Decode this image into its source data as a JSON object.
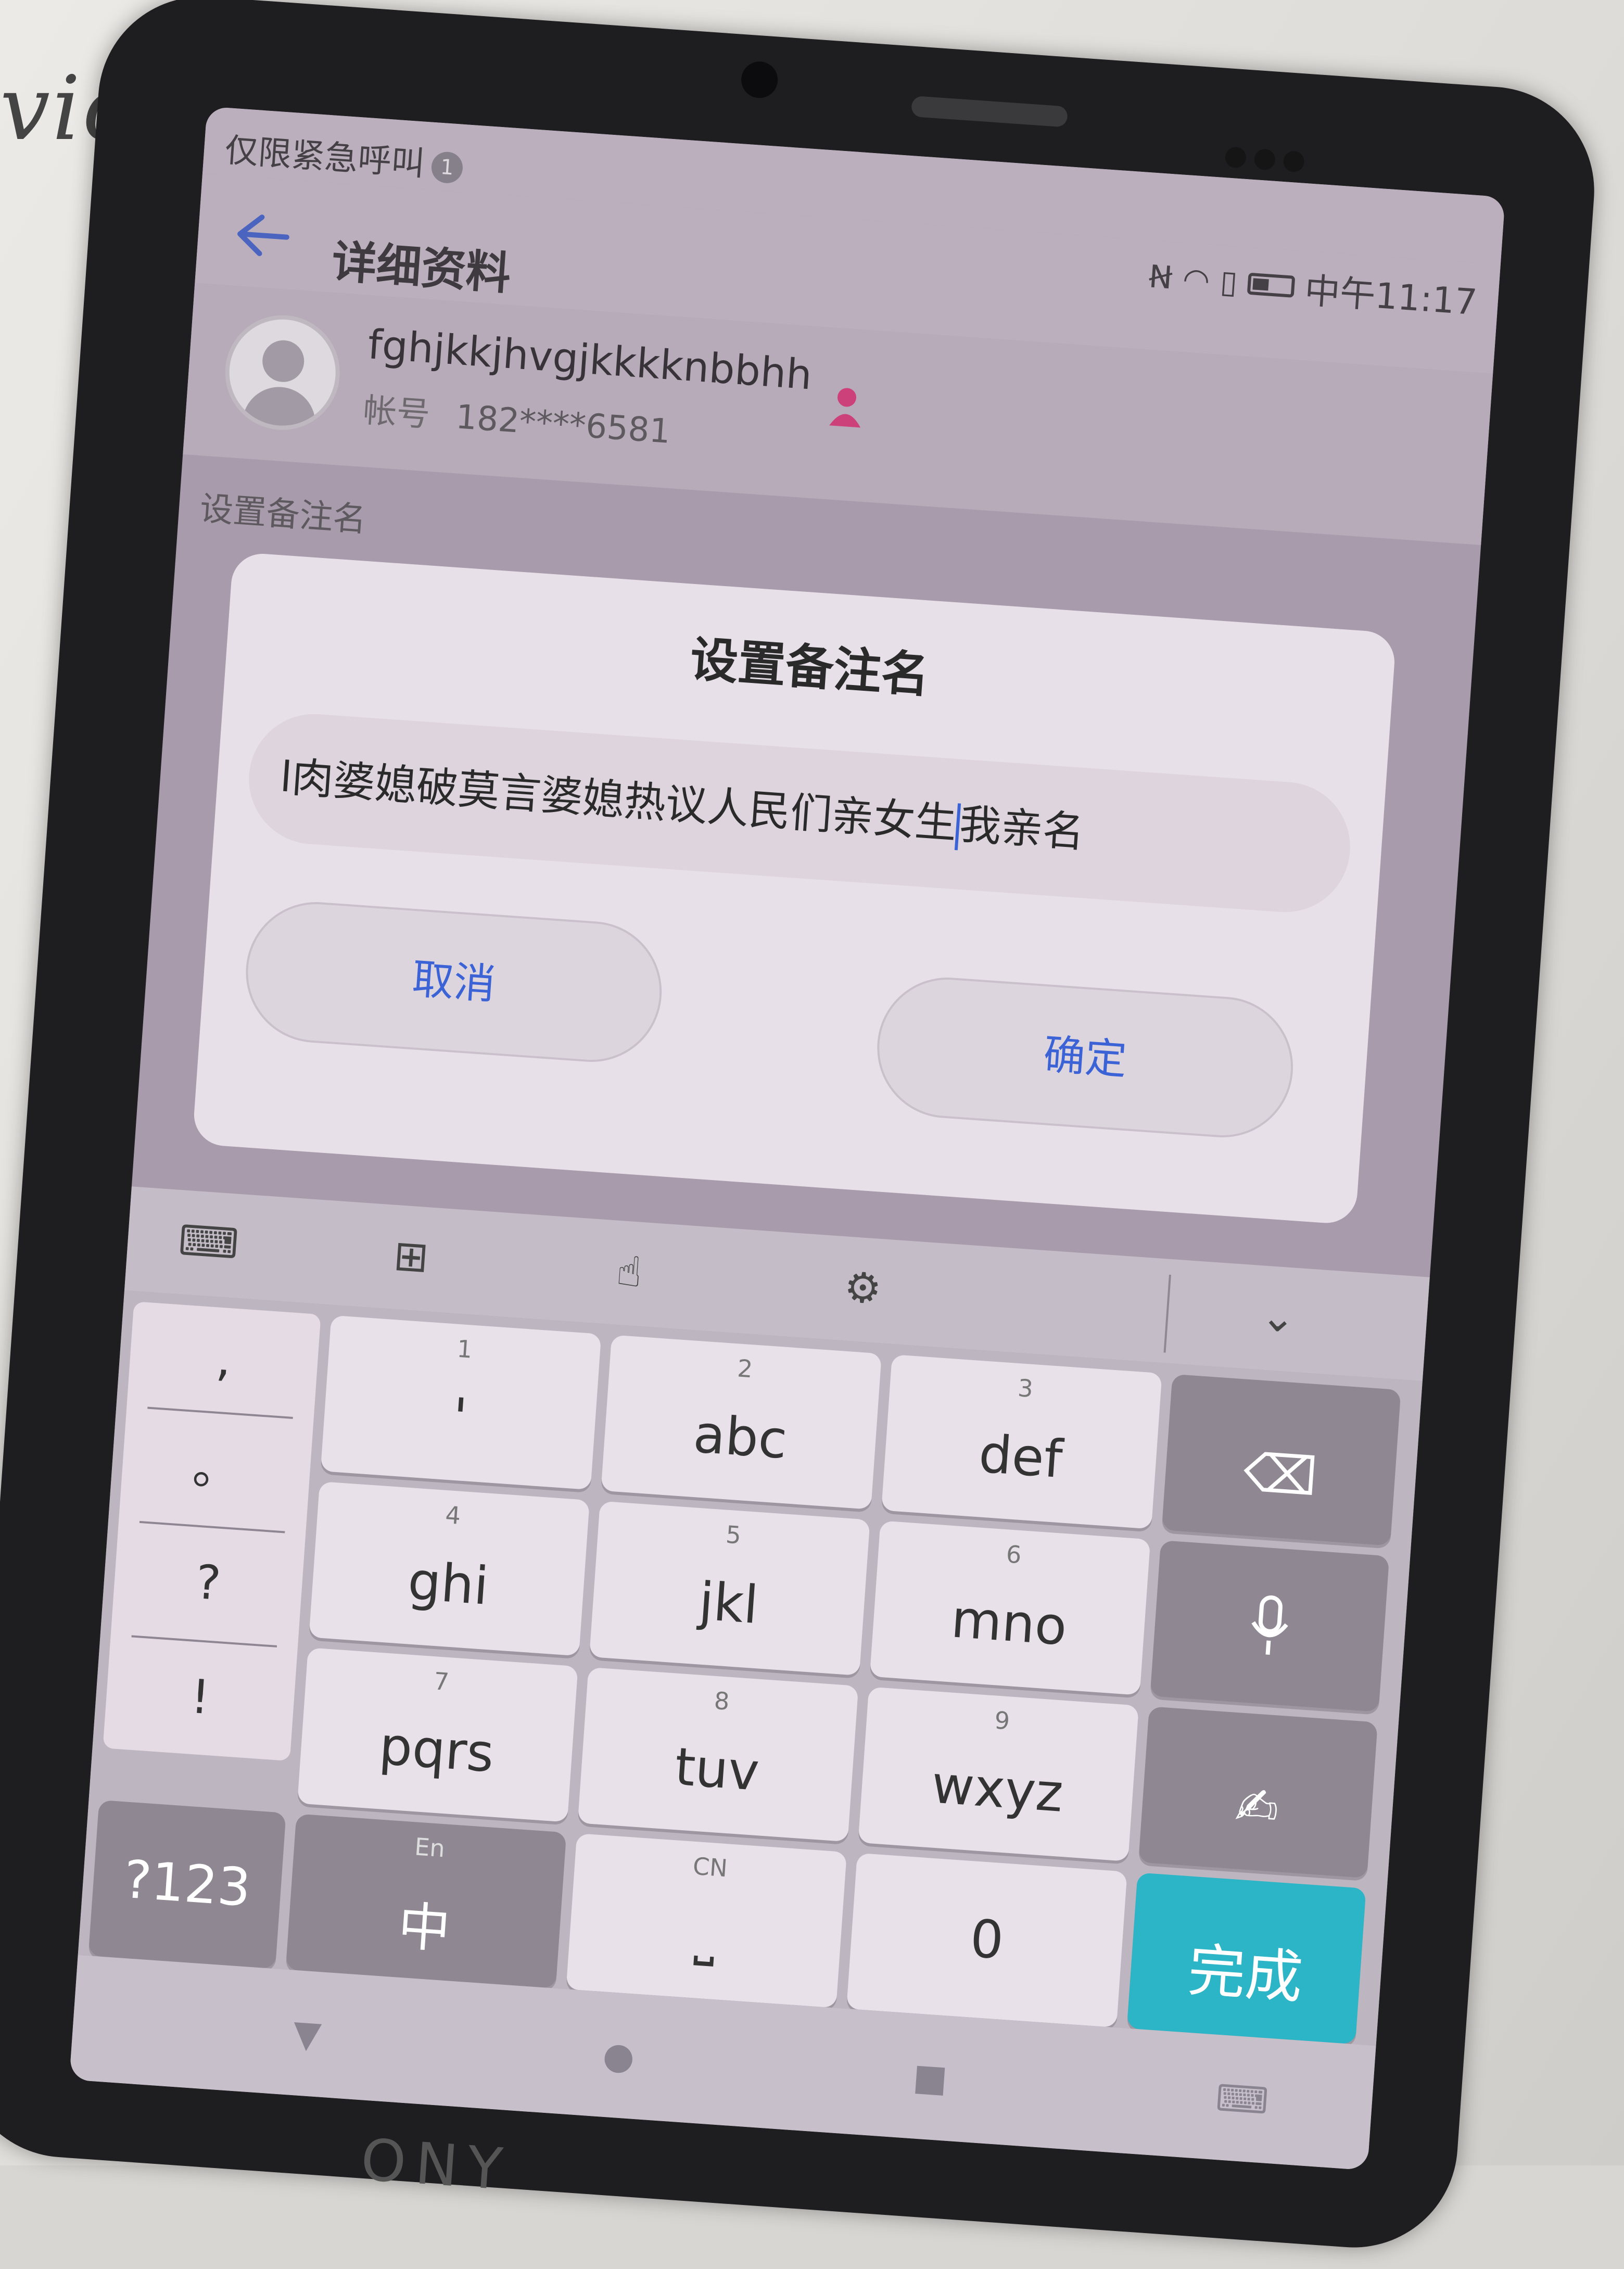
{
  "background": {
    "scribble": "vices"
  },
  "status": {
    "emergency_text": "仅限紧急呼叫",
    "notification_count": "1",
    "time": "中午11:17",
    "icons": [
      "nfc-icon",
      "wifi-icon",
      "no-sim-icon",
      "battery-icon"
    ]
  },
  "header": {
    "title": "详细资料"
  },
  "profile": {
    "nickname": "fghjkkjhvgjkkkknbbhh",
    "account_label": "帐号",
    "account_value": "182****6581",
    "gender_color": "#e8357a"
  },
  "section_hint": "设置备注名",
  "dialog": {
    "title": "设置备注名",
    "input_before_caret": "l肉婆媳破莫言婆媳热议人民们亲女生",
    "input_after_caret": "我亲名",
    "cancel_label": "取消",
    "confirm_label": "确定"
  },
  "keyboard": {
    "toolbar": [
      "keyboard-icon",
      "layout-icon",
      "one-hand-icon",
      "settings-icon",
      "collapse-icon"
    ],
    "side_symbols": [
      ",",
      "。",
      "?",
      "!"
    ],
    "keys": [
      {
        "num": "1",
        "letters": "'"
      },
      {
        "num": "2",
        "letters": "abc"
      },
      {
        "num": "3",
        "letters": "def"
      },
      {
        "num": "4",
        "letters": "ghi"
      },
      {
        "num": "5",
        "letters": "jkl"
      },
      {
        "num": "6",
        "letters": "mno"
      },
      {
        "num": "7",
        "letters": "pqrs"
      },
      {
        "num": "8",
        "letters": "tuv"
      },
      {
        "num": "9",
        "letters": "wxyz"
      }
    ],
    "symbols_key": "?123",
    "lang_key_small": "En",
    "lang_key_big": "中",
    "space_key_small": "CN",
    "zero_key": "0",
    "done_key": "完成",
    "accent_color": "#2cb5c6"
  },
  "device_brand": "ONY"
}
